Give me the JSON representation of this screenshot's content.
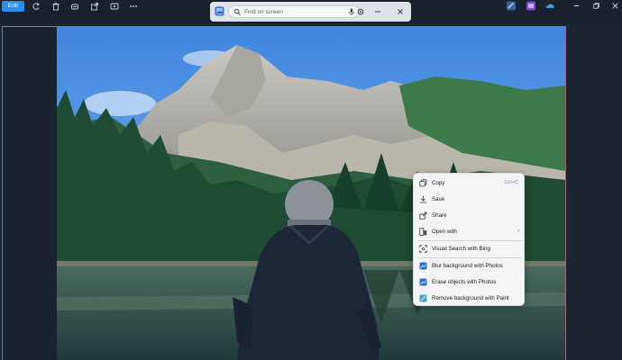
{
  "toolbar": {
    "edit_label": "Edit",
    "tools": [
      "rotate-icon",
      "delete-icon",
      "copy-icon",
      "share-icon",
      "video-icon",
      "more-icon"
    ]
  },
  "window": {
    "search_placeholder": "Find on screen",
    "right_icons": [
      "paint-icon",
      "photos-icon",
      "onedrive-icon"
    ],
    "controls": [
      "minimize-icon",
      "restore-icon",
      "close-icon"
    ]
  },
  "menu": {
    "items": [
      {
        "label": "Copy",
        "shortcut": "Ctrl+C",
        "icon": "copy-icon"
      },
      {
        "label": "Save",
        "icon": "save-icon"
      },
      {
        "label": "Share",
        "icon": "share-icon"
      },
      {
        "label": "Open with",
        "icon": "open-with-icon",
        "submenu": "›"
      },
      {
        "label": "Visual Search with Bing",
        "icon": "visual-search-icon"
      },
      {
        "label": "Blur background with Photos",
        "icon": "photos-icon"
      },
      {
        "label": "Erase objects with Photos",
        "icon": "photos-icon"
      },
      {
        "label": "Remove background with Paint",
        "icon": "paint-icon"
      }
    ]
  },
  "colors": {
    "accent": "#2a8ee8",
    "frame_left": "#3a90d8",
    "frame_right": "#d84a7a"
  }
}
